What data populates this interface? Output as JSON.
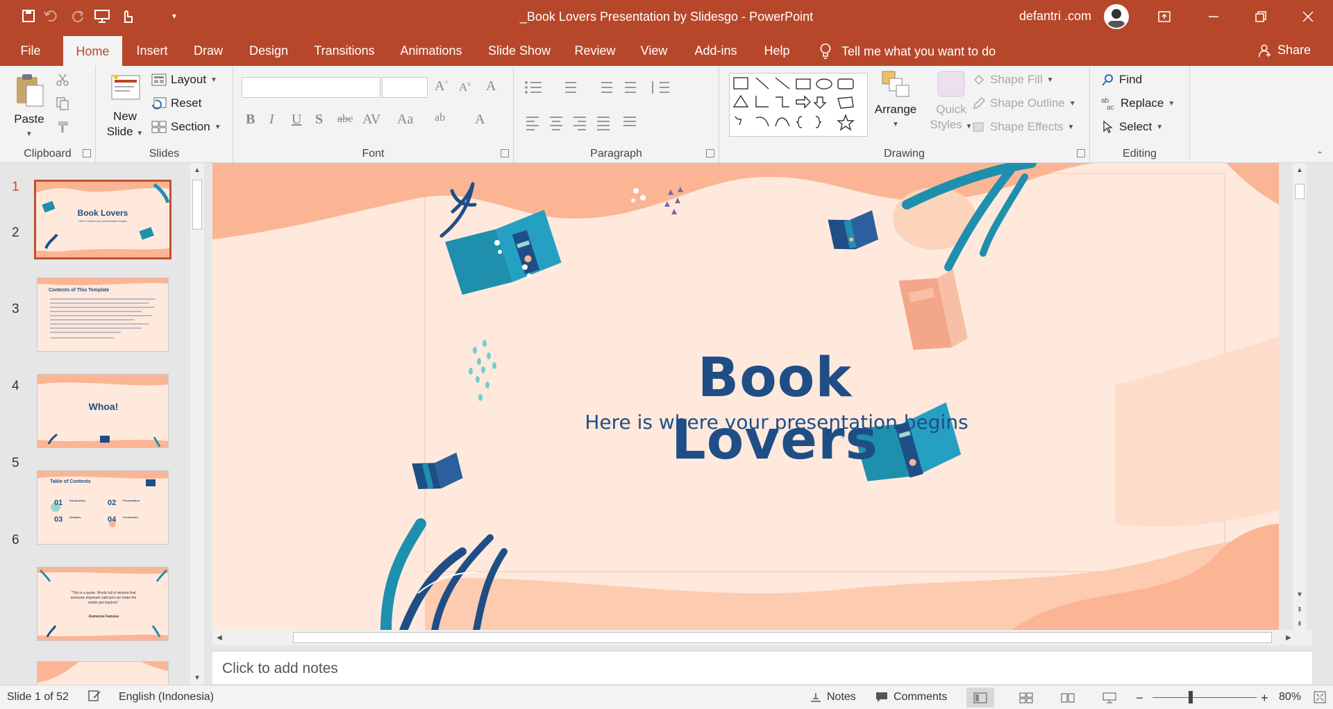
{
  "window": {
    "title": "_Book Lovers Presentation by Slidesgo  -  PowerPoint",
    "user": "defantri .com"
  },
  "tabs": [
    "File",
    "Home",
    "Insert",
    "Draw",
    "Design",
    "Transitions",
    "Animations",
    "Slide Show",
    "Review",
    "View",
    "Add-ins",
    "Help"
  ],
  "tell_me": "Tell me what you want to do",
  "share": "Share",
  "clipboard": {
    "label": "Clipboard",
    "paste": "Paste"
  },
  "slides_group": {
    "label": "Slides",
    "new_slide_1": "New",
    "new_slide_2": "Slide",
    "layout": "Layout",
    "reset": "Reset",
    "section": "Section"
  },
  "font_group": {
    "label": "Font",
    "font_name": "",
    "font_size": ""
  },
  "paragraph_group": {
    "label": "Paragraph"
  },
  "drawing_group": {
    "label": "Drawing",
    "arrange": "Arrange",
    "quick_1": "Quick",
    "quick_2": "Styles",
    "shape_fill": "Shape Fill",
    "shape_outline": "Shape Outline",
    "shape_effects": "Shape Effects"
  },
  "editing_group": {
    "label": "Editing",
    "find": "Find",
    "replace": "Replace",
    "select": "Select"
  },
  "thumbs": [
    {
      "num": "1",
      "title": "Book Lovers",
      "sub": "Here is where your presentation begins"
    },
    {
      "num": "2",
      "title": "Contents of This Template"
    },
    {
      "num": "3",
      "title": "Whoa!"
    },
    {
      "num": "4",
      "title": "Table of Contents",
      "items": [
        "01",
        "02",
        "03",
        "04"
      ],
      "labels": [
        "Introduction",
        "Presentation",
        "Analysis",
        "Conclusion"
      ]
    },
    {
      "num": "5",
      "quote": "\"This is a quote. Words full of wisdom that someone important said and can make the reader get inspired.\"",
      "author": "-Someone Famous"
    },
    {
      "num": "6"
    }
  ],
  "slide": {
    "title": "Book Lovers",
    "subtitle": "Here is where your presentation begins"
  },
  "notes_placeholder": "Click to add notes",
  "status": {
    "slide": "Slide 1 of 52",
    "language": "English (Indonesia)",
    "notes": "Notes",
    "comments": "Comments",
    "zoom": "80%"
  },
  "colors": {
    "accent": "#b7472a",
    "slide_bg": "#ffe9dd",
    "peach": "#fbb594",
    "navy": "#1f4e86",
    "teal": "#1f8fae"
  }
}
